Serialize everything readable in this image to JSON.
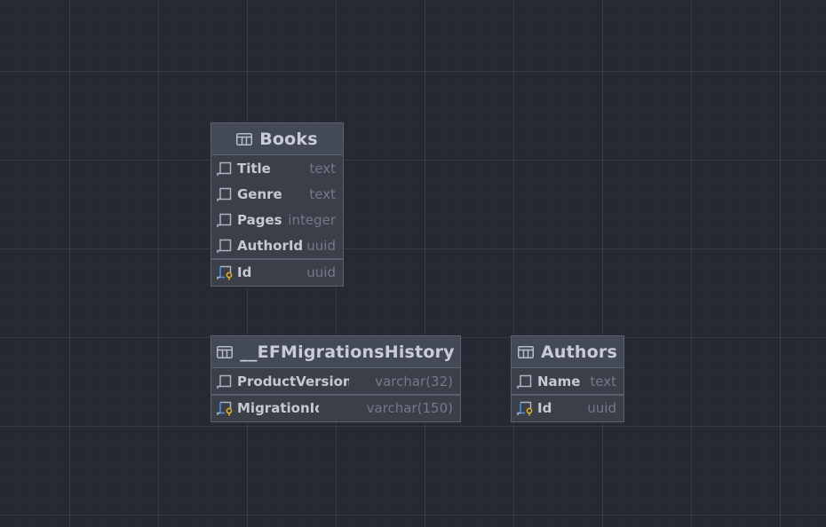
{
  "tables": {
    "books": {
      "name": "Books",
      "columns": [
        {
          "name": "Title",
          "type": "text"
        },
        {
          "name": "Genre",
          "type": "text"
        },
        {
          "name": "Pages",
          "type": "integer"
        },
        {
          "name": "AuthorId",
          "type": "uuid"
        }
      ],
      "primary_key": {
        "name": "Id",
        "type": "uuid"
      }
    },
    "ef_migrations_history": {
      "name": "__EFMigrationsHistory",
      "columns": [
        {
          "name": "ProductVersion",
          "type": "varchar(32)"
        }
      ],
      "primary_key": {
        "name": "MigrationId",
        "type": "varchar(150)"
      }
    },
    "authors": {
      "name": "Authors",
      "columns": [
        {
          "name": "Name",
          "type": "text"
        }
      ],
      "primary_key": {
        "name": "Id",
        "type": "uuid"
      }
    }
  },
  "colors": {
    "canvas_background": "#262932",
    "card_background": "#3b3f4a",
    "header_background": "#444957",
    "key_icon_accent": "#e6b422",
    "pk_icon_accent": "#4a8fe8"
  },
  "icons": {
    "table": "table-grid-icon",
    "column": "column-icon",
    "primary_key_column": "primary-key-column-icon"
  }
}
